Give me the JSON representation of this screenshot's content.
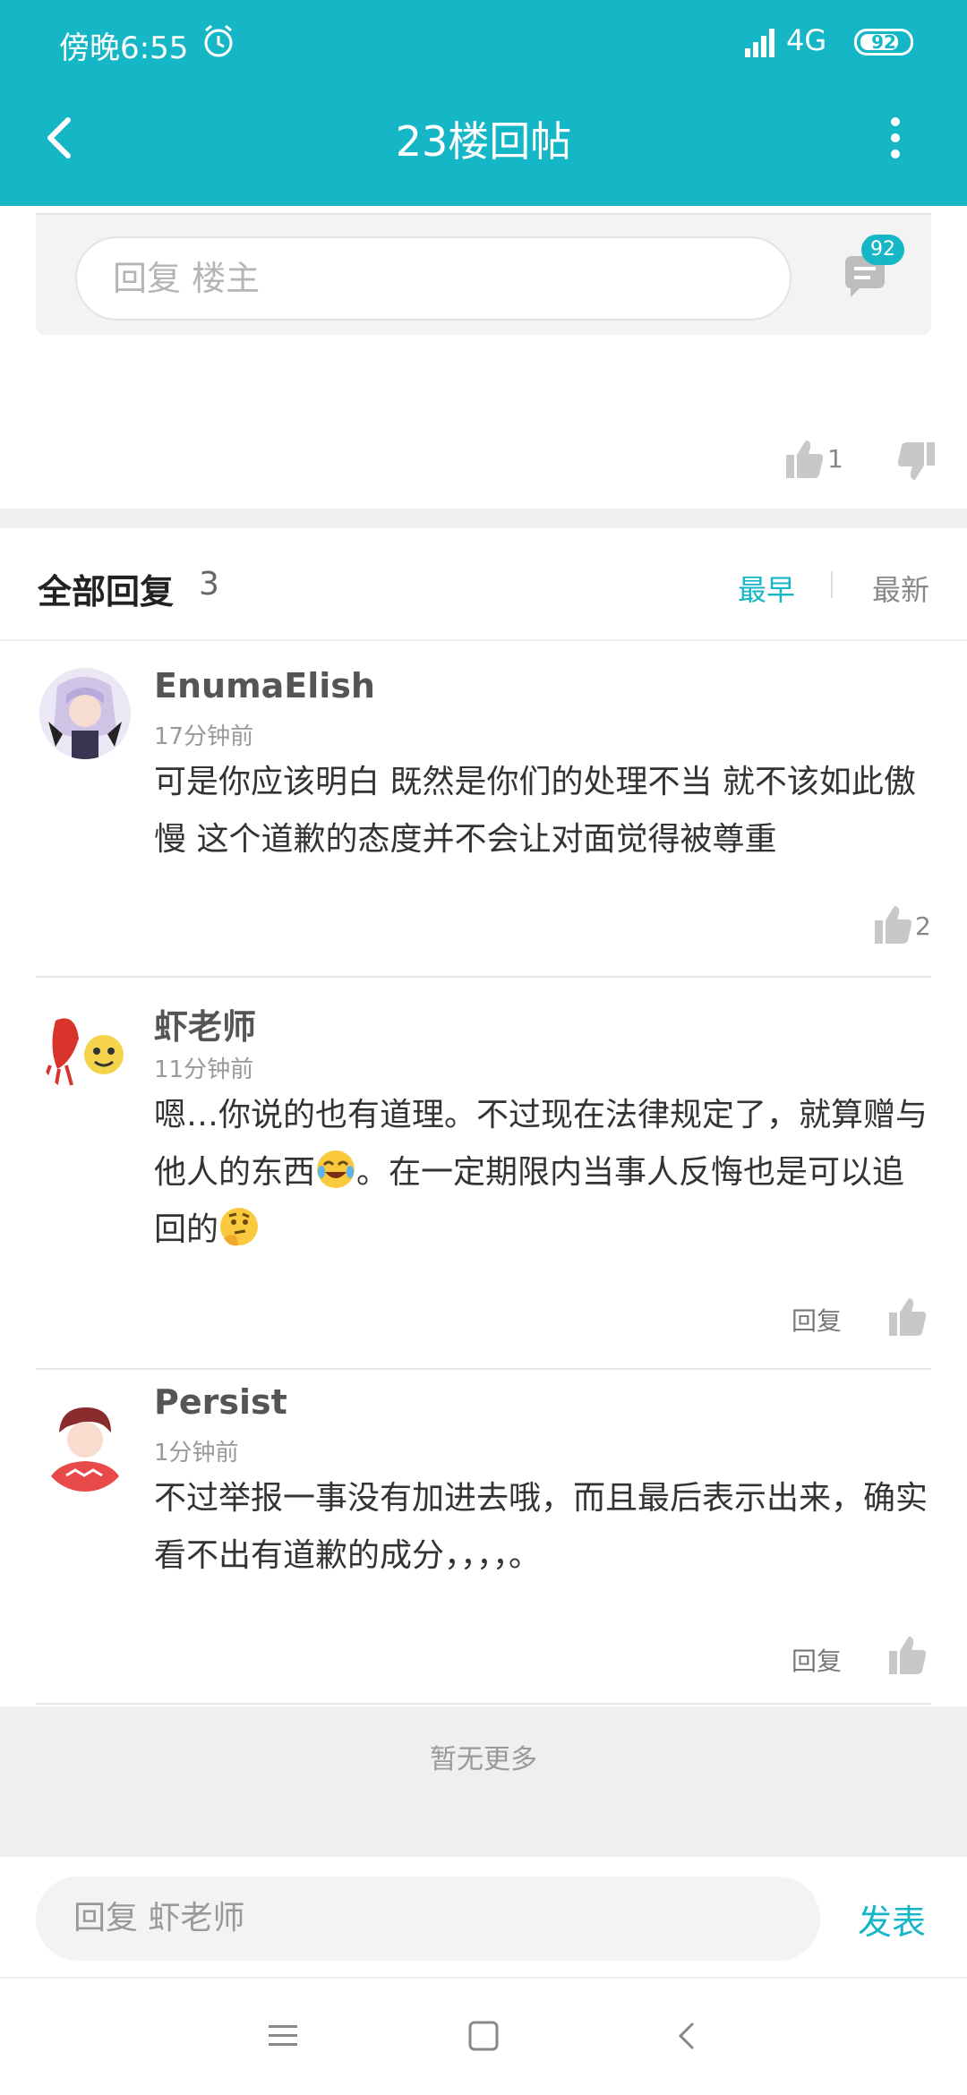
{
  "status_bar": {
    "time": "傍晚6:55",
    "network": "4G",
    "battery": "92"
  },
  "header": {
    "title": "23楼回帖"
  },
  "post_box": {
    "reply_placeholder": "回复  楼主",
    "comment_badge": "92",
    "like_count": "1"
  },
  "replies_header": {
    "label": "全部回复",
    "count": "3",
    "sort_earliest": "最早",
    "sort_latest": "最新"
  },
  "replies": [
    {
      "name": "EnumaElish",
      "time": "17分钟前",
      "content": "可是你应该明白 既然是你们的处理不当 就不该如此傲慢 这个道歉的态度并不会让对面觉得被尊重",
      "like_count": "2"
    },
    {
      "name": "虾老师",
      "time": "11分钟前",
      "content_part1": "嗯…你说的也有道理。不过现在法律规定了，就算赠与他人的东西",
      "content_part2": "。在一定期限内当事人反悔也是可以追回的",
      "reply_label": "回复"
    },
    {
      "name": "Persist",
      "time": "1分钟前",
      "content": "不过举报一事没有加进去哦，而且最后表示出来，确实看不出有道歉的成分，，，，。",
      "reply_label": "回复"
    }
  ],
  "footer": {
    "no_more": "暂无更多",
    "reply_placeholder": "回复 虾老师",
    "publish": "发表"
  },
  "colors": {
    "accent": "#15b7c7",
    "background": "#ffffff",
    "band": "#efefef"
  }
}
